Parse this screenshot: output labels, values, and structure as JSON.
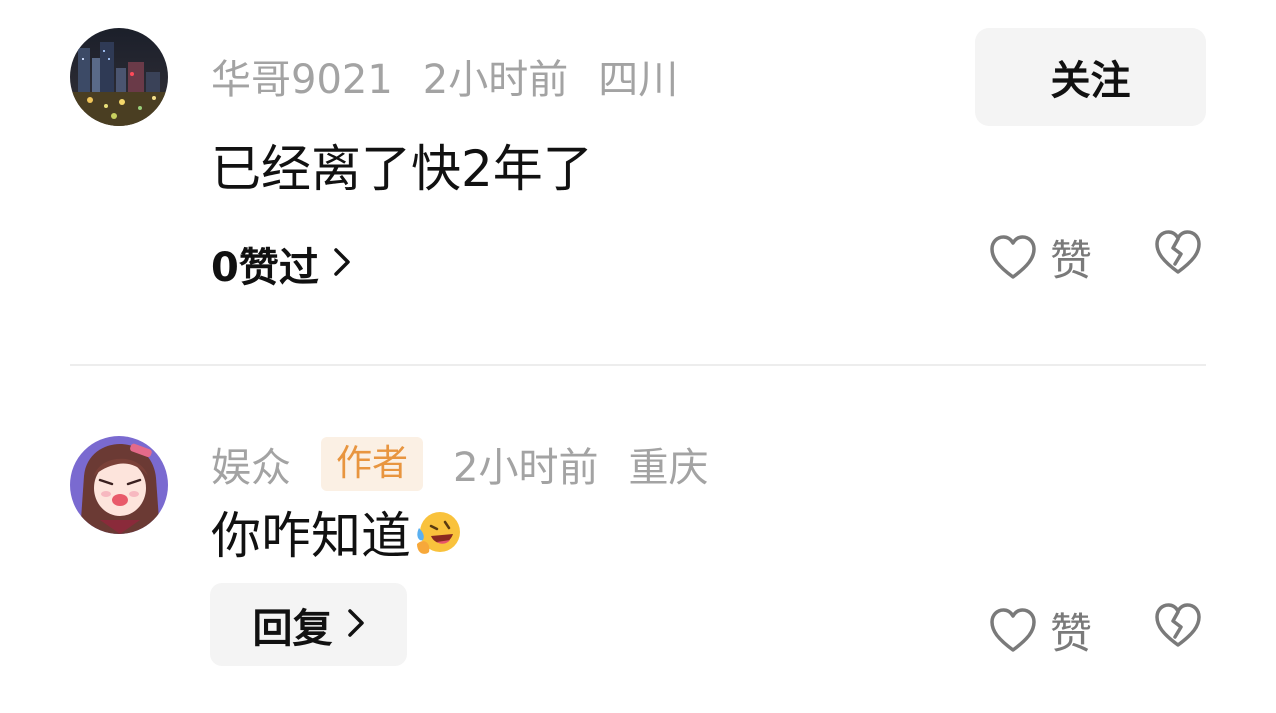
{
  "comments": [
    {
      "username": "华哥9021",
      "time": "2小时前",
      "location": "四川",
      "text": "已经离了快2年了",
      "likes_summary": "0赞过",
      "follow_label": "关注",
      "like_label": "赞",
      "avatar_icon": "city-night-avatar",
      "badge": ""
    },
    {
      "username": "娱众",
      "badge": "作者",
      "time": "2小时前",
      "location": "重庆",
      "text": "你咋知道",
      "emoji": "crying-laughing-emoji",
      "reply_label": "回复",
      "like_label": "赞",
      "avatar_icon": "anime-girl-avatar"
    }
  ],
  "colors": {
    "meta_text": "#a3a3a3",
    "badge_bg": "#fbf0e4",
    "badge_text": "#e8953f",
    "button_bg": "#f4f4f4",
    "icon_gray": "#7a7a7a"
  }
}
